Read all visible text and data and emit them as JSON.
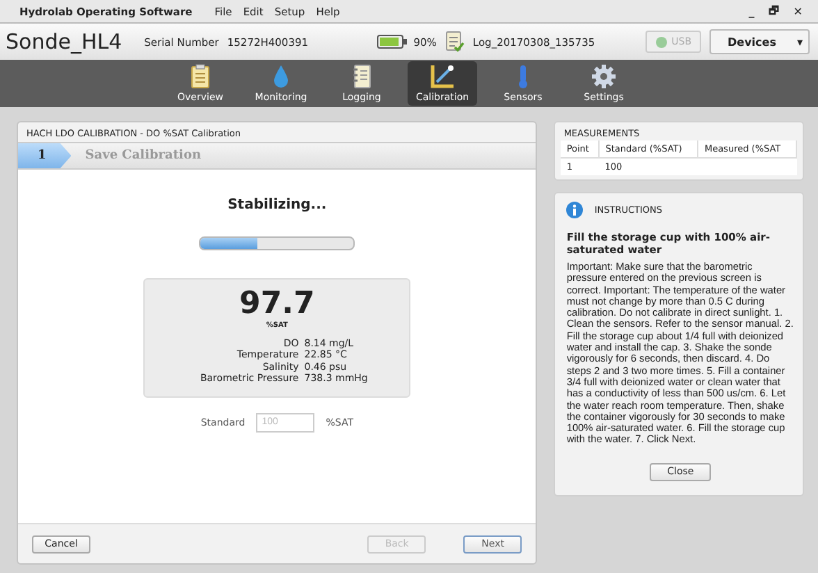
{
  "window": {
    "title": "Hydrolab Operating Software",
    "menu": [
      "File",
      "Edit",
      "Setup",
      "Help"
    ],
    "controls": [
      "_",
      "🗗",
      "✕"
    ]
  },
  "header": {
    "device": "Sonde_HL4",
    "serial_label": "Serial Number",
    "serial": "15272H400391",
    "battery": {
      "level": 0.9
    },
    "battery_text": "90%",
    "log": "Log_20170308_135735",
    "usb": {
      "label": "USB",
      "disabled": true
    },
    "devices": "Devices",
    "devices_caret": "▾"
  },
  "nav": [
    {
      "label": "Overview",
      "selected": false
    },
    {
      "label": "Monitoring",
      "selected": false
    },
    {
      "label": "Logging",
      "selected": false
    },
    {
      "label": "Calibration",
      "selected": true
    },
    {
      "label": "Sensors",
      "selected": false
    },
    {
      "label": "Settings",
      "selected": false
    }
  ],
  "calibration": {
    "title": "HACH LDO CALIBRATION - DO %SAT Calibration",
    "steps": [
      {
        "label": "1",
        "selected": true
      },
      {
        "label": "Save Calibration",
        "selected": false
      }
    ],
    "status": "Stabilizing...",
    "progress": {
      "level": 0.37
    },
    "reading": {
      "value": "97.7",
      "unit": "%SAT",
      "details": [
        {
          "label": "DO",
          "value": "8.14 mg/L"
        },
        {
          "label": "Temperature",
          "value": "22.85 °C"
        },
        {
          "label": "Salinity",
          "value": "0.46 psu"
        },
        {
          "label": "Barometric Pressure",
          "value": "738.3 mmHg"
        }
      ]
    },
    "standard": {
      "label": "Standard",
      "placeholder": "100",
      "unit": "%SAT"
    },
    "buttons": [
      {
        "label": "Cancel",
        "disabled": false
      },
      {
        "label": "Back",
        "disabled": true
      },
      {
        "label": "Next",
        "disabled": false
      }
    ]
  },
  "measurements": {
    "title": "MEASUREMENTS",
    "columns": [
      "Point",
      "Standard (%SAT)",
      "Measured (%SAT"
    ],
    "rows": [
      [
        "1",
        "100",
        ""
      ]
    ]
  },
  "instructions": {
    "title": "INSTRUCTIONS",
    "heading": "Fill the storage cup with 100% air-saturated water",
    "body": "Important: Make sure that the barometric pressure entered on the previous screen is correct. Important: The temperature of the water must not change by more than 0.5 C during calibration. Do not calibrate in direct sunlight. 1. Clean the sensors. Refer to the sensor manual. 2. Fill the storage cup about 1/4 full with deionized water and install the cap. 3. Shake the sonde vigorously for 6 seconds, then discard. 4. Do steps 2 and 3 two more times. 5. Fill a container 3/4 full with deionized water or clean water that has a conductivity of less than 500 us/cm. 6. Let the water reach  room temperature. Then, shake the container vigorously for 30 seconds to make 100% air-saturated water. 6. Fill the storage cup with the water. 7. Click Next.",
    "close": "Close"
  }
}
